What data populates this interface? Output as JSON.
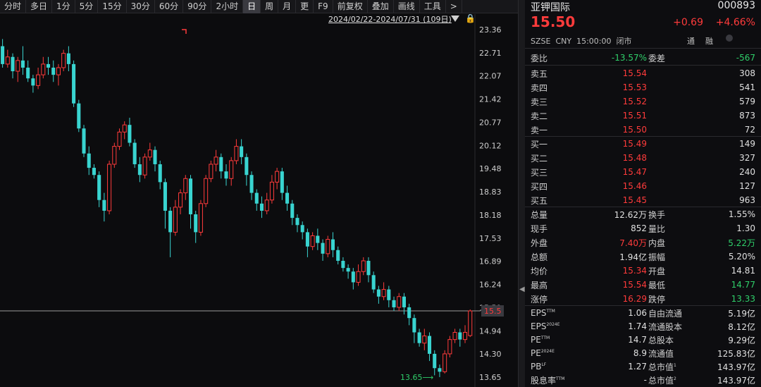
{
  "toolbar": {
    "items": [
      "分时",
      "多日",
      "1分",
      "5分",
      "15分",
      "30分",
      "60分",
      "90分",
      "2小时",
      "日",
      "周",
      "月",
      "更",
      "F9",
      "前复权",
      "叠加",
      "画线",
      "工具",
      ">"
    ]
  },
  "chart": {
    "date_range": "2024/02/22-2024/07/31 (109日)",
    "price_axis": [
      "23.36",
      "22.71",
      "22.07",
      "21.42",
      "20.77",
      "20.12",
      "19.48",
      "18.83",
      "18.18",
      "17.53",
      "16.89",
      "16.24",
      "15.59",
      "14.94",
      "14.30",
      "13.65"
    ],
    "current_price_tag": "15.5",
    "low_label": "13.65⟶"
  },
  "quote": {
    "name": "亚钾国际",
    "code": "000893",
    "price": "15.50",
    "change": "+0.69",
    "change_pct": "+4.66%",
    "market_line": "SZSE  CNY  15:00:00  闭市",
    "tong": "通",
    "rong": "融",
    "weibi_label": "委比",
    "weibi": "-13.57%",
    "weicha_label": "委差",
    "weicha": "-567",
    "asks": [
      {
        "label": "卖五",
        "price": "15.54",
        "vol": "308"
      },
      {
        "label": "卖四",
        "price": "15.53",
        "vol": "541"
      },
      {
        "label": "卖三",
        "price": "15.52",
        "vol": "579"
      },
      {
        "label": "卖二",
        "price": "15.51",
        "vol": "873"
      },
      {
        "label": "卖一",
        "price": "15.50",
        "vol": "72"
      }
    ],
    "bids": [
      {
        "label": "买一",
        "price": "15.49",
        "vol": "149"
      },
      {
        "label": "买二",
        "price": "15.48",
        "vol": "327"
      },
      {
        "label": "买三",
        "price": "15.47",
        "vol": "240"
      },
      {
        "label": "买四",
        "price": "15.46",
        "vol": "127"
      },
      {
        "label": "买五",
        "price": "15.45",
        "vol": "963"
      }
    ],
    "stats": [
      {
        "l1": "总量",
        "v1": "12.62万",
        "l2": "换手",
        "v2": "1.55%"
      },
      {
        "l1": "现手",
        "v1": "852",
        "l2": "量比",
        "v2": "1.30"
      },
      {
        "l1": "外盘",
        "v1": "7.40万",
        "l2": "内盘",
        "v2": "5.22万"
      },
      {
        "l1": "总额",
        "v1": "1.94亿",
        "l2": "振幅",
        "v2": "5.20%"
      },
      {
        "l1": "均价",
        "v1": "15.34",
        "l2": "开盘",
        "v2": "14.81"
      },
      {
        "l1": "最高",
        "v1": "15.54",
        "l2": "最低",
        "v2": "14.77"
      },
      {
        "l1": "涨停",
        "v1": "16.29",
        "l2": "跌停",
        "v2": "13.33"
      }
    ],
    "fundamentals": [
      {
        "l1": "EPS",
        "sup1": "TTM",
        "v1": "1.06",
        "l2": "自由流通",
        "v2": "5.19亿"
      },
      {
        "l1": "EPS",
        "sup1": "2024E",
        "v1": "1.74",
        "l2": "流通股本",
        "v2": "8.12亿"
      },
      {
        "l1": "PE",
        "sup1": "TTM",
        "v1": "14.7",
        "l2": "总股本",
        "v2": "9.29亿"
      },
      {
        "l1": "PE",
        "sup1": "2024E",
        "v1": "8.9",
        "l2": "流通值",
        "v2": "125.83亿"
      },
      {
        "l1": "PB",
        "sup1": "LF",
        "v1": "1.27",
        "l2": "总市值",
        "sup2": "1",
        "v2": "143.97亿"
      },
      {
        "l1": "股息率",
        "sup1": "TTM",
        "v1": "-",
        "l2": "总市值",
        "sup2": "2",
        "v2": "143.97亿"
      }
    ]
  },
  "colors": {
    "up": "#ff3b3b",
    "down": "#39d4d0",
    "accent": "#e8b34a"
  },
  "chart_data": {
    "type": "candlestick",
    "y_ticks": [
      23.36,
      22.71,
      22.07,
      21.42,
      20.77,
      20.12,
      19.48,
      18.83,
      18.18,
      17.53,
      16.89,
      16.24,
      15.59,
      14.94,
      14.3,
      13.65
    ],
    "ylim": [
      13.55,
      23.6
    ],
    "last_price": 15.5,
    "period_low": 13.65,
    "candles": [
      [
        22.9,
        22.4,
        23.1,
        22.3
      ],
      [
        22.4,
        22.6,
        22.8,
        22.3
      ],
      [
        22.6,
        22.2,
        22.7,
        22.0
      ],
      [
        22.2,
        22.5,
        22.6,
        21.9
      ],
      [
        22.5,
        22.3,
        22.9,
        22.1
      ],
      [
        22.3,
        22.0,
        22.5,
        21.9
      ],
      [
        22.0,
        21.8,
        22.1,
        21.6
      ],
      [
        21.8,
        22.1,
        22.3,
        21.7
      ],
      [
        22.1,
        22.4,
        22.6,
        22.0
      ],
      [
        22.4,
        22.3,
        22.6,
        22.1
      ],
      [
        22.3,
        22.1,
        22.5,
        21.9
      ],
      [
        22.1,
        22.3,
        22.4,
        21.8
      ],
      [
        22.3,
        22.7,
        22.8,
        22.2
      ],
      [
        22.7,
        22.4,
        22.9,
        22.2
      ],
      [
        22.4,
        21.3,
        22.5,
        21.2
      ],
      [
        21.3,
        20.6,
        21.4,
        20.5
      ],
      [
        20.6,
        19.9,
        20.7,
        19.8
      ],
      [
        19.9,
        19.5,
        20.1,
        19.3
      ],
      [
        19.5,
        19.3,
        19.6,
        19.2
      ],
      [
        19.3,
        18.6,
        19.4,
        18.4
      ],
      [
        18.6,
        18.3,
        18.8,
        18.0
      ],
      [
        18.3,
        19.6,
        19.7,
        18.2
      ],
      [
        19.6,
        20.1,
        20.2,
        19.5
      ],
      [
        20.1,
        20.5,
        20.6,
        20.0
      ],
      [
        20.5,
        20.7,
        20.8,
        20.3
      ],
      [
        20.7,
        20.2,
        20.9,
        20.1
      ],
      [
        20.2,
        19.6,
        20.3,
        19.5
      ],
      [
        19.6,
        19.3,
        19.8,
        19.1
      ],
      [
        19.3,
        19.8,
        19.9,
        19.2
      ],
      [
        19.8,
        20.0,
        20.2,
        19.7
      ],
      [
        20.0,
        19.6,
        20.1,
        19.4
      ],
      [
        19.6,
        19.1,
        19.7,
        18.9
      ],
      [
        19.1,
        18.3,
        19.2,
        17.8
      ],
      [
        18.3,
        17.7,
        18.4,
        17.0
      ],
      [
        17.7,
        18.4,
        18.6,
        17.6
      ],
      [
        18.4,
        18.8,
        18.9,
        18.2
      ],
      [
        18.8,
        19.2,
        19.3,
        18.6
      ],
      [
        19.2,
        18.2,
        19.3,
        17.8
      ],
      [
        18.2,
        17.7,
        18.3,
        17.4
      ],
      [
        17.7,
        18.5,
        18.6,
        17.6
      ],
      [
        18.5,
        19.2,
        19.3,
        18.4
      ],
      [
        19.2,
        19.6,
        19.7,
        19.1
      ],
      [
        19.6,
        19.8,
        20.0,
        19.4
      ],
      [
        19.8,
        19.4,
        19.9,
        19.2
      ],
      [
        19.4,
        19.2,
        19.6,
        19.0
      ],
      [
        19.2,
        19.7,
        19.8,
        19.0
      ],
      [
        19.7,
        20.1,
        20.3,
        19.6
      ],
      [
        20.1,
        19.8,
        20.3,
        19.6
      ],
      [
        19.8,
        19.3,
        19.9,
        19.0
      ],
      [
        19.3,
        18.8,
        19.4,
        18.6
      ],
      [
        18.8,
        18.5,
        18.9,
        18.3
      ],
      [
        18.5,
        18.3,
        18.7,
        18.1
      ],
      [
        18.3,
        18.6,
        18.8,
        18.2
      ],
      [
        18.6,
        19.1,
        19.3,
        18.5
      ],
      [
        19.1,
        19.4,
        19.5,
        18.9
      ],
      [
        19.4,
        18.8,
        19.5,
        18.6
      ],
      [
        18.8,
        18.5,
        19.0,
        18.3
      ],
      [
        18.5,
        18.1,
        18.6,
        17.9
      ],
      [
        18.1,
        17.9,
        18.2,
        17.7
      ],
      [
        17.9,
        17.7,
        18.0,
        17.5
      ],
      [
        17.7,
        17.3,
        17.8,
        17.0
      ],
      [
        17.3,
        17.6,
        17.7,
        17.2
      ],
      [
        17.6,
        17.4,
        17.8,
        17.2
      ],
      [
        17.4,
        17.1,
        17.5,
        16.9
      ],
      [
        17.1,
        17.5,
        17.6,
        17.0
      ],
      [
        17.5,
        17.2,
        17.7,
        17.0
      ],
      [
        17.2,
        16.9,
        17.3,
        16.8
      ],
      [
        16.9,
        16.7,
        17.0,
        16.6
      ],
      [
        16.7,
        16.6,
        16.8,
        16.4
      ],
      [
        16.6,
        16.3,
        16.7,
        16.1
      ],
      [
        16.3,
        16.6,
        16.8,
        16.2
      ],
      [
        16.6,
        16.9,
        17.0,
        16.5
      ],
      [
        16.9,
        16.5,
        17.0,
        16.3
      ],
      [
        16.5,
        16.1,
        16.6,
        16.0
      ],
      [
        16.1,
        15.9,
        16.2,
        15.7
      ],
      [
        15.9,
        16.1,
        16.3,
        15.8
      ],
      [
        16.1,
        15.8,
        16.2,
        15.6
      ],
      [
        15.8,
        15.6,
        15.9,
        15.5
      ],
      [
        15.6,
        15.9,
        16.0,
        15.5
      ],
      [
        15.9,
        15.6,
        16.0,
        15.4
      ],
      [
        15.6,
        15.3,
        15.7,
        15.1
      ],
      [
        15.3,
        14.9,
        15.4,
        14.6
      ],
      [
        14.9,
        14.6,
        15.0,
        14.5
      ],
      [
        14.6,
        14.8,
        15.0,
        14.4
      ],
      [
        14.8,
        14.3,
        14.9,
        14.1
      ],
      [
        14.3,
        13.9,
        14.4,
        13.7
      ],
      [
        13.9,
        13.8,
        14.0,
        13.65
      ],
      [
        13.8,
        14.3,
        14.4,
        13.75
      ],
      [
        14.3,
        14.7,
        14.8,
        14.2
      ],
      [
        14.7,
        14.9,
        15.0,
        14.6
      ],
      [
        14.9,
        14.7,
        15.0,
        14.5
      ],
      [
        14.7,
        14.9,
        15.1,
        14.6
      ],
      [
        14.81,
        15.5,
        15.54,
        14.77
      ]
    ]
  }
}
